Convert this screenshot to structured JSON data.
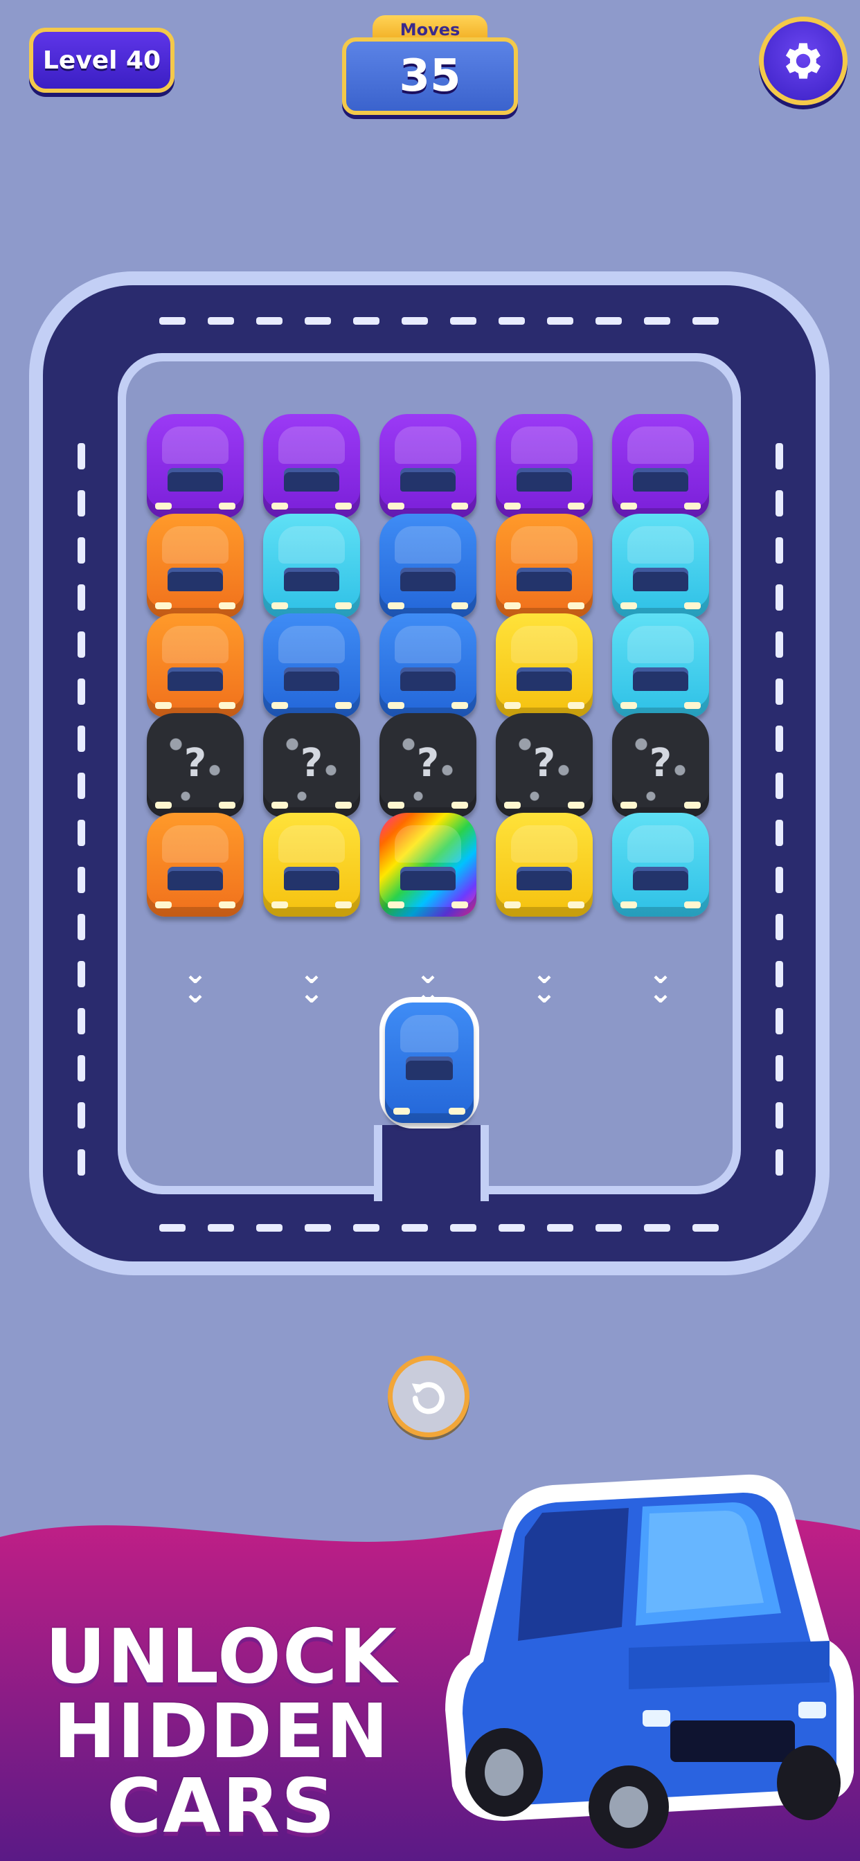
{
  "hud": {
    "level_label": "Level 40",
    "moves_label": "Moves",
    "moves_value": "35",
    "settings_icon": "gear-icon"
  },
  "colors": {
    "background": "#8e9acb",
    "road": "#2a2b6e",
    "hud_gold": "#f4c94a",
    "promo_magenta": "#b0207a"
  },
  "parking": {
    "columns": [
      {
        "cars": [
          "purple",
          "orange",
          "orange",
          "mystery",
          "orange"
        ]
      },
      {
        "cars": [
          "purple",
          "cyan",
          "blue",
          "mystery",
          "yellow"
        ]
      },
      {
        "cars": [
          "purple",
          "blue",
          "blue",
          "mystery",
          "rainbow"
        ]
      },
      {
        "cars": [
          "purple",
          "orange",
          "yellow",
          "mystery",
          "yellow"
        ]
      },
      {
        "cars": [
          "purple",
          "cyan",
          "cyan",
          "mystery",
          "cyan"
        ]
      }
    ],
    "mystery_symbol": "?",
    "exit_arrow": "chevron-down-icon",
    "active_car": "blue"
  },
  "controls": {
    "undo_icon": "undo-icon"
  },
  "promo": {
    "line1": "UNLOCK",
    "line2": "HIDDEN",
    "line3": "CARS",
    "car_color": "blue"
  }
}
